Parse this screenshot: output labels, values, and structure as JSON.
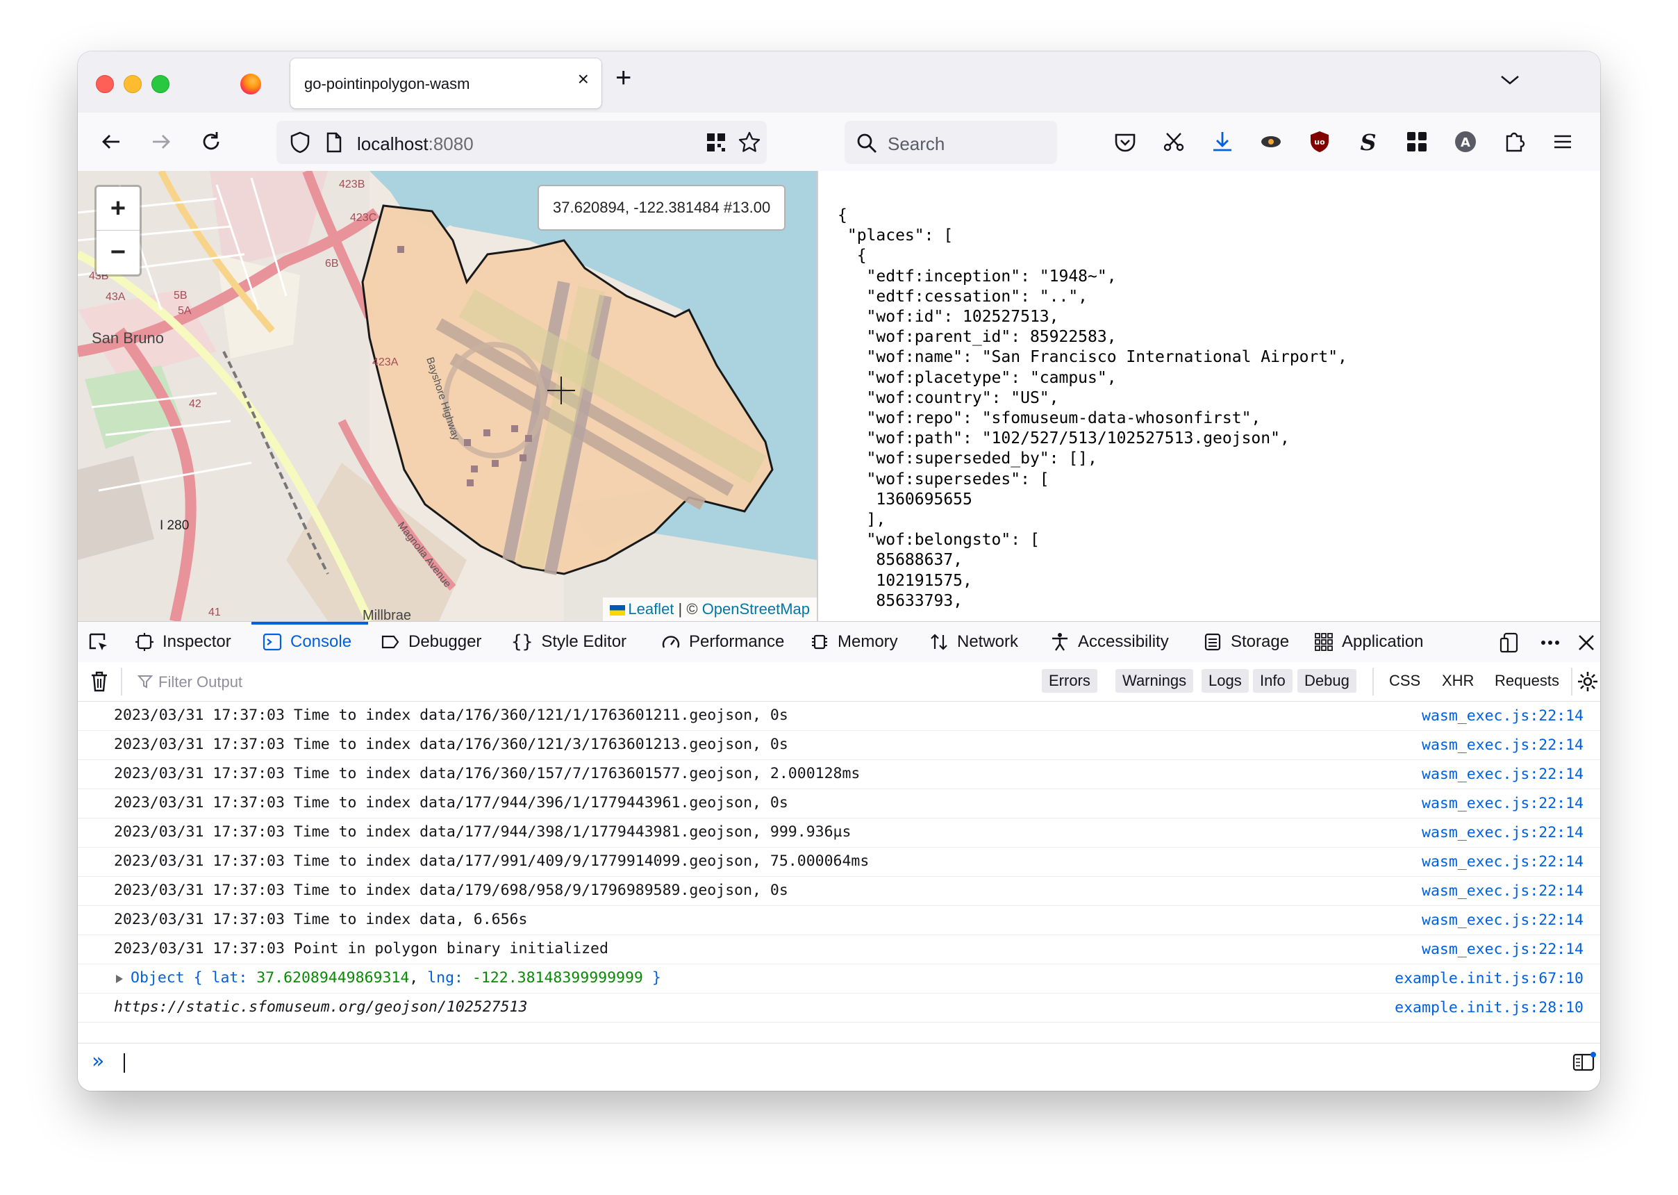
{
  "browser": {
    "tab_title": "go-pointinpolygon-wasm",
    "tab_close": "×",
    "new_tab": "+",
    "url_host": "localhost",
    "url_port": ":8080",
    "search_placeholder": "Search"
  },
  "map": {
    "zoom_in": "+",
    "zoom_out": "−",
    "coordinates": "37.620894, -122.381484 #13.00",
    "attribution_leaflet": "Leaflet",
    "attribution_sep": " | © ",
    "attribution_osm": "OpenStreetMap",
    "labels": {
      "san_bruno": "San Bruno",
      "i280": "I 280",
      "millbrae": "Millbrae",
      "r423b": "423B",
      "r423c": "423C",
      "r423a": "423A",
      "r43b": "43B",
      "r43a": "43A",
      "r5b": "5B",
      "r5a": "5A",
      "r6b": "6B",
      "r42": "42",
      "r41": "41",
      "bayshore": "Bayshore Highway",
      "magnolia": "Magnolia Avenue"
    }
  },
  "json_text": "{\n \"places\": [\n  {\n   \"edtf:inception\": \"1948~\",\n   \"edtf:cessation\": \"..\",\n   \"wof:id\": 102527513,\n   \"wof:parent_id\": 85922583,\n   \"wof:name\": \"San Francisco International Airport\",\n   \"wof:placetype\": \"campus\",\n   \"wof:country\": \"US\",\n   \"wof:repo\": \"sfomuseum-data-whosonfirst\",\n   \"wof:path\": \"102/527/513/102527513.geojson\",\n   \"wof:superseded_by\": [],\n   \"wof:supersedes\": [\n    1360695655\n   ],\n   \"wof:belongsto\": [\n    85688637,\n    102191575,\n    85633793,",
  "devtools": {
    "tabs": [
      "Inspector",
      "Console",
      "Debugger",
      "Style Editor",
      "Performance",
      "Memory",
      "Network",
      "Accessibility",
      "Storage",
      "Application"
    ],
    "filter_placeholder": "Filter Output",
    "levels": [
      "Errors",
      "Warnings",
      "Logs",
      "Info",
      "Debug"
    ],
    "extras": [
      "CSS",
      "XHR",
      "Requests"
    ],
    "logs": [
      {
        "msg": "2023/03/31 17:37:03 Time to index data/176/360/121/1/1763601211.geojson, 0s",
        "src": "wasm_exec.js:22:14"
      },
      {
        "msg": "2023/03/31 17:37:03 Time to index data/176/360/121/3/1763601213.geojson, 0s",
        "src": "wasm_exec.js:22:14"
      },
      {
        "msg": "2023/03/31 17:37:03 Time to index data/176/360/157/7/1763601577.geojson, 2.000128ms",
        "src": "wasm_exec.js:22:14"
      },
      {
        "msg": "2023/03/31 17:37:03 Time to index data/177/944/396/1/1779443961.geojson, 0s",
        "src": "wasm_exec.js:22:14"
      },
      {
        "msg": "2023/03/31 17:37:03 Time to index data/177/944/398/1/1779443981.geojson, 999.936µs",
        "src": "wasm_exec.js:22:14"
      },
      {
        "msg": "2023/03/31 17:37:03 Time to index data/177/991/409/9/1779914099.geojson, 75.000064ms",
        "src": "wasm_exec.js:22:14"
      },
      {
        "msg": "2023/03/31 17:37:03 Time to index data/179/698/958/9/1796989589.geojson, 0s",
        "src": "wasm_exec.js:22:14"
      },
      {
        "msg": "2023/03/31 17:37:03 Time to index data, 6.656s",
        "src": "wasm_exec.js:22:14"
      },
      {
        "msg": "2023/03/31 17:37:03 Point in polygon binary initialized",
        "src": "wasm_exec.js:22:14"
      }
    ],
    "object_row": {
      "prefix": "Object { ",
      "lat_key": "lat: ",
      "lat": "37.62089449869314",
      "sep": ", ",
      "lng_key": "lng: ",
      "lng": "-122.38148399999999",
      "suffix": " }",
      "src": "example.init.js:67:10"
    },
    "url_row": {
      "msg": "https://static.sfomuseum.org/geojson/102527513",
      "src": "example.init.js:28:10"
    },
    "prompt_symbol": "»"
  }
}
